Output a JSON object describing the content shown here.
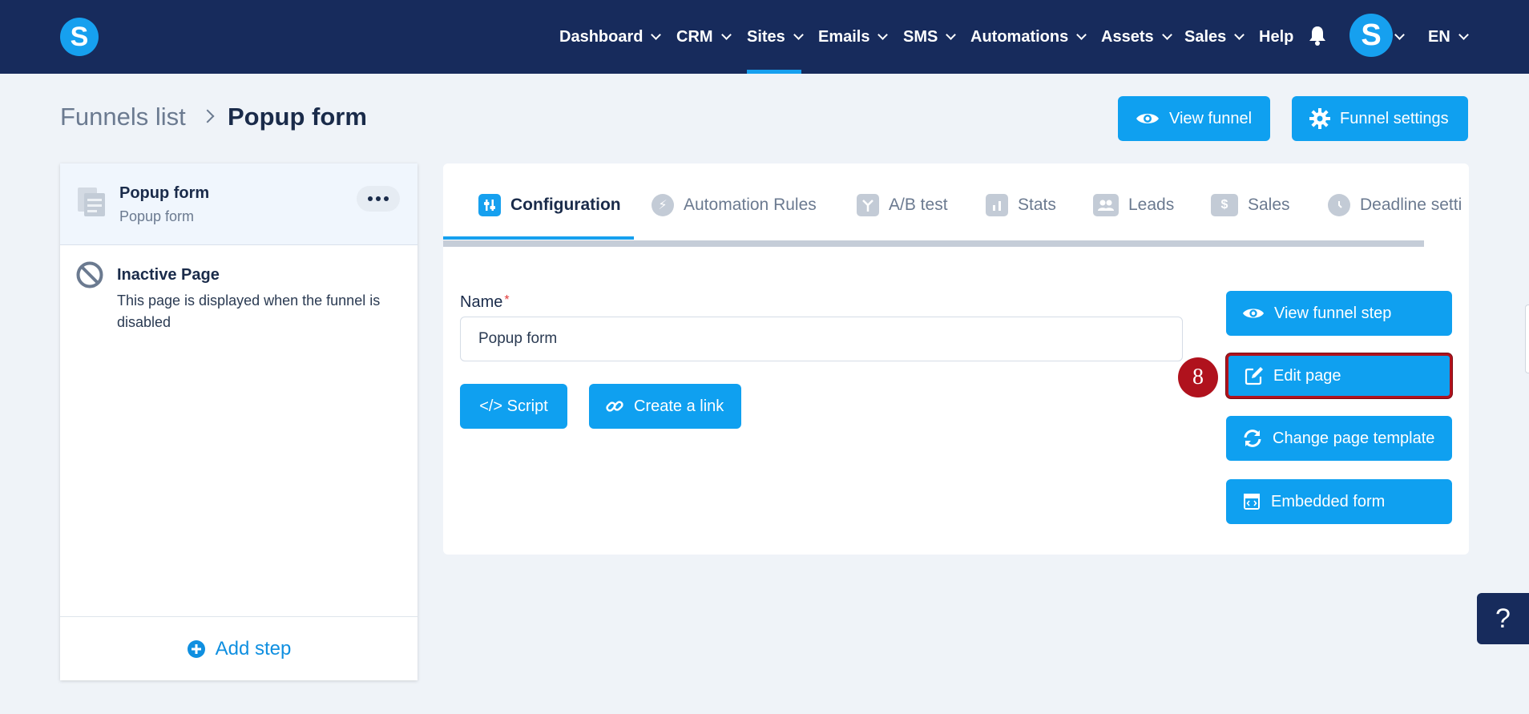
{
  "topbar": {
    "logo_letter": "S",
    "nav": [
      {
        "label": "Dashboard"
      },
      {
        "label": "CRM"
      },
      {
        "label": "Sites"
      },
      {
        "label": "Emails"
      },
      {
        "label": "SMS"
      },
      {
        "label": "Automations"
      },
      {
        "label": "Assets"
      },
      {
        "label": "Sales"
      },
      {
        "label": "Help"
      }
    ],
    "active_nav": "Sites",
    "avatar_letter": "S",
    "language": "EN"
  },
  "breadcrumb": {
    "parent": "Funnels list",
    "current": "Popup form"
  },
  "header_buttons": {
    "view_funnel": "View funnel",
    "funnel_settings": "Funnel settings"
  },
  "steps": [
    {
      "title": "Popup form",
      "subtitle": "Popup form",
      "icon": "page-icon"
    },
    {
      "title": "Inactive Page",
      "subtitle": "This page is displayed when the funnel is disabled",
      "icon": "ban-icon"
    }
  ],
  "add_step": "Add step",
  "tabs": [
    {
      "label": "Configuration",
      "icon": "sliders-icon",
      "active": true
    },
    {
      "label": "Automation Rules",
      "icon": "bolt-icon"
    },
    {
      "label": "A/B test",
      "icon": "split-icon"
    },
    {
      "label": "Stats",
      "icon": "chart-icon"
    },
    {
      "label": "Leads",
      "icon": "users-icon"
    },
    {
      "label": "Sales",
      "icon": "dollar-icon"
    },
    {
      "label": "Deadline setti",
      "icon": "clock-icon"
    }
  ],
  "form": {
    "name_label": "Name",
    "required_mark": "*",
    "name_value": "Popup form"
  },
  "actions": {
    "script": "</> Script",
    "create_link": "Create a link",
    "view_step": "View funnel step",
    "edit_page": "Edit page",
    "change_template": "Change page template",
    "embedded_form": "Embedded form"
  },
  "annotation_badge": "8",
  "help_label": "?",
  "colors": {
    "topbar": "#172b5c",
    "accent": "#0fa0f0",
    "badge": "#b0121d",
    "highlight_border": "#b0121d"
  }
}
